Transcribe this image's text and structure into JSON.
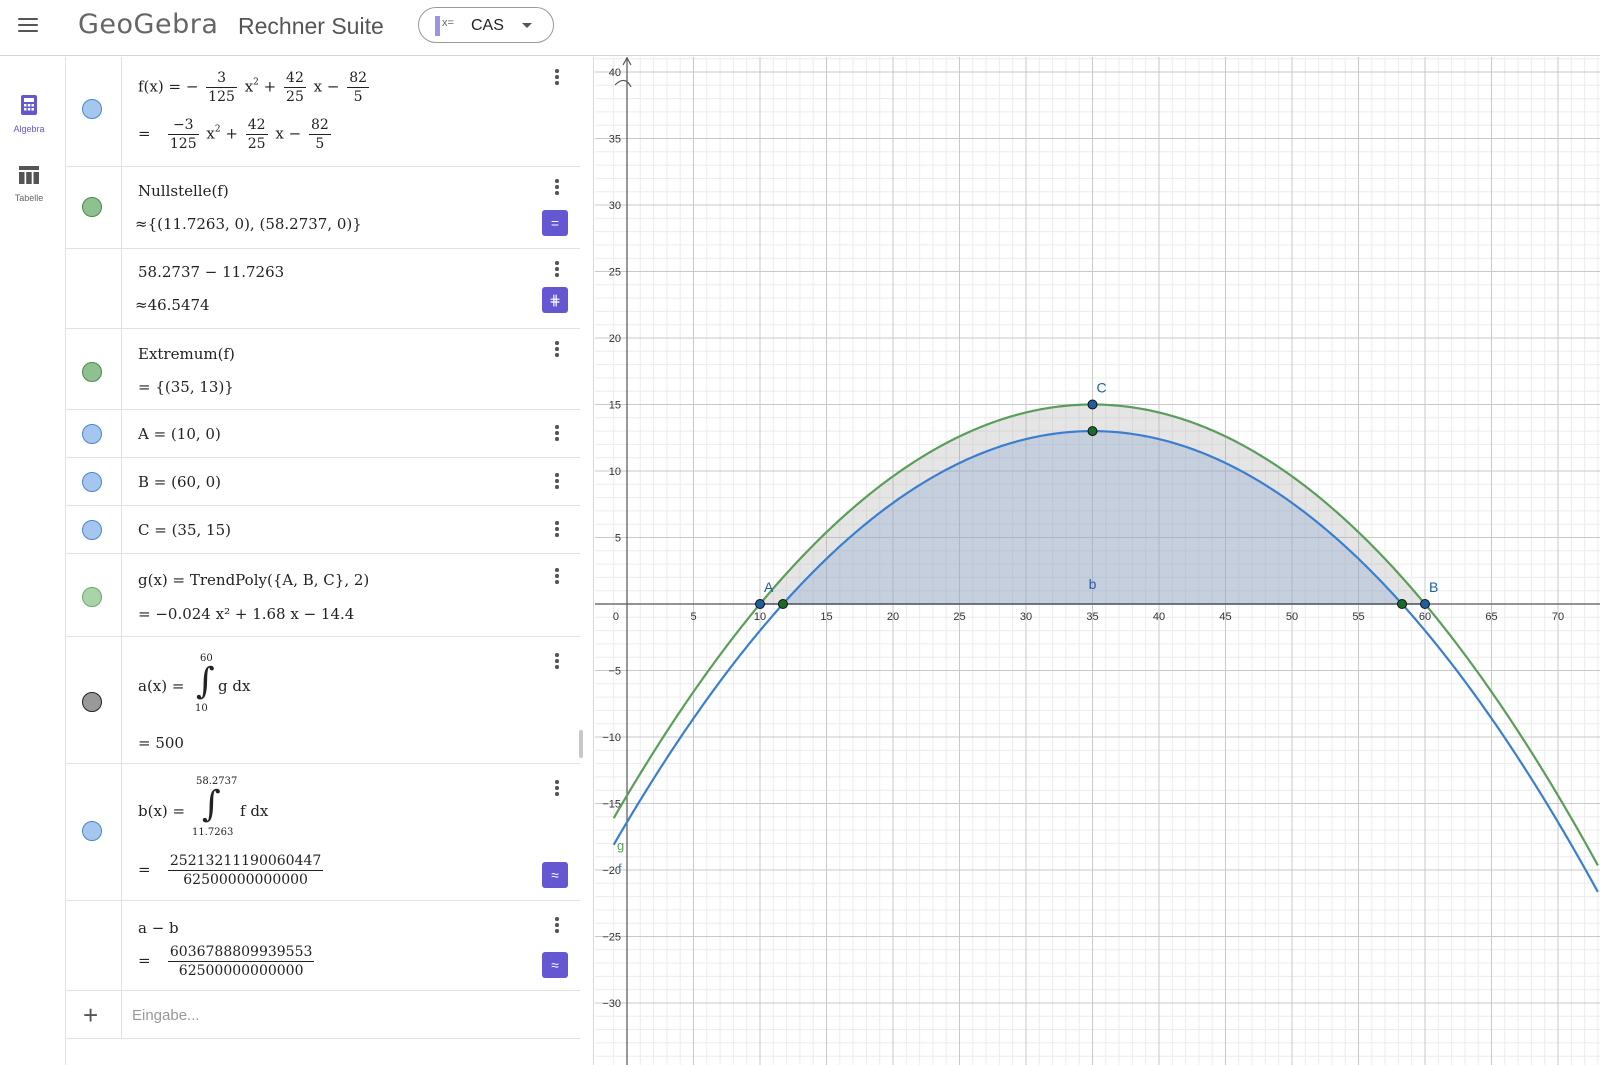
{
  "header": {
    "brand": "GeoGebra",
    "suite_title": "Rechner Suite",
    "app_picker": {
      "icon_text": "x=",
      "label": "CAS"
    }
  },
  "rail": {
    "items": [
      {
        "label": "Algebra",
        "icon": "calculator-icon",
        "active": true
      },
      {
        "label": "Tabelle",
        "icon": "table-icon",
        "active": false
      }
    ]
  },
  "algebra": {
    "rows": {
      "f_def": {
        "lhs": "f(x)  =  −",
        "n1": "3",
        "d1": "125",
        "m1": "x",
        "e1": "2",
        "p1": "+",
        "n2": "42",
        "d2": "25",
        "m2": "x  −",
        "n3": "82",
        "d3": "5"
      },
      "f_out": {
        "eq": "=",
        "n1": "−3",
        "d1": "125",
        "m1": "x",
        "e1": "2",
        "p1": "+",
        "n2": "42",
        "d2": "25",
        "m2": "x  −",
        "n3": "82",
        "d3": "5"
      },
      "nullstelle": {
        "input": "Nullstelle(f)",
        "output": "≈{(11.7263, 0), (58.2737, 0)}",
        "button": "="
      },
      "diff": {
        "input": "58.2737 − 11.7263",
        "output": "≈46.5474",
        "button": "⋕"
      },
      "extremum": {
        "input": "Extremum(f)",
        "output": "=   {(35, 13)}"
      },
      "A": {
        "input": "A  =  (10, 0)"
      },
      "B": {
        "input": "B  =  (60, 0)"
      },
      "C": {
        "input": "C  =  (35, 15)"
      },
      "g": {
        "input": "g(x)  =  TrendPoly({A, B, C}, 2)",
        "output": "=   −0.024 x² + 1.68 x − 14.4"
      },
      "a": {
        "lhs": "a(x)  =",
        "upper": "60",
        "lower": "10",
        "integrand": "g dx",
        "output": "=   500"
      },
      "b": {
        "lhs": "b(x)  =",
        "upper": "58.2737",
        "lower": "11.7263",
        "integrand": "f dx",
        "eq": "=",
        "num": "25213211190060447",
        "den": "62500000000000",
        "button": "≈"
      },
      "ab": {
        "input": "a − b",
        "eq": "=",
        "num": "6036788809939553",
        "den": "62500000000000",
        "button": "≈"
      }
    },
    "input_placeholder": "Eingabe..."
  },
  "chart_data": {
    "type": "line",
    "xlim": [
      -1,
      72
    ],
    "ylim": [
      -34,
      41
    ],
    "x_ticks": [
      5,
      10,
      15,
      20,
      25,
      30,
      35,
      40,
      45,
      50,
      55,
      60,
      65,
      70
    ],
    "y_ticks": [
      -30,
      -25,
      -20,
      -15,
      -10,
      -5,
      5,
      10,
      15,
      20,
      25,
      30,
      35,
      40
    ],
    "origin_label": "0",
    "grid": true,
    "series": [
      {
        "name": "f",
        "expression": "-3/125 x^2 + 42/25 x - 82/5",
        "color": "#3a7fcf"
      },
      {
        "name": "g",
        "expression": "-0.024 x^2 + 1.68 x - 14.4",
        "color": "#5a9e5a"
      }
    ],
    "points": [
      {
        "name": "A",
        "x": 10,
        "y": 0
      },
      {
        "name": "B",
        "x": 60,
        "y": 0
      },
      {
        "name": "C",
        "x": 35,
        "y": 15
      },
      {
        "name": "",
        "x": 11.7263,
        "y": 0
      },
      {
        "name": "",
        "x": 58.2737,
        "y": 0
      },
      {
        "name": "",
        "x": 35,
        "y": 13
      }
    ],
    "shaded_integrals": [
      {
        "name": "a",
        "function": "g",
        "from": 10,
        "to": 60
      },
      {
        "name": "b",
        "function": "f",
        "from": 11.7263,
        "to": 58.2737
      }
    ],
    "labels": {
      "b": "b",
      "f": "f",
      "g": "g"
    },
    "colors": {
      "f": "#3a7fcf",
      "g": "#5a9e5a",
      "grid_major": "#c9c9c9",
      "grid_minor": "#ececec",
      "accent": "#6557d2"
    }
  }
}
